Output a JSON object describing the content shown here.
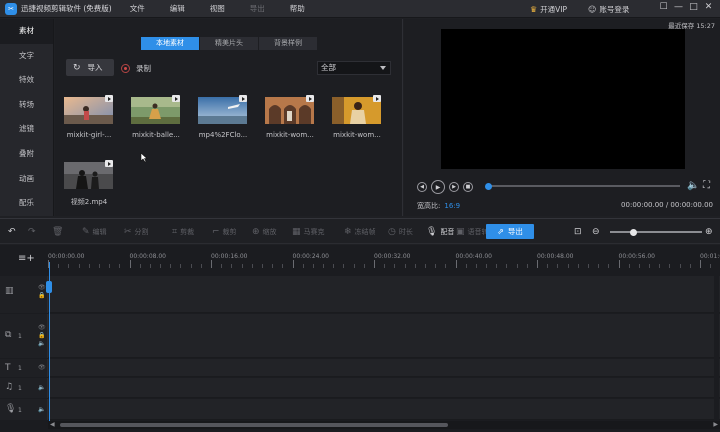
{
  "app": {
    "title": "迅捷视频剪辑软件 (免费版)",
    "logo_icon": "scissors-logo",
    "vip_label": "开通VIP",
    "login_label": "账号登录"
  },
  "menu": [
    "文件",
    "编辑",
    "视图",
    "导出",
    "帮助"
  ],
  "window_buttons": {
    "skin": "☐",
    "minimize": "—",
    "maximize": "□",
    "close": "✕"
  },
  "leftnav": [
    "素材",
    "文字",
    "特效",
    "转场",
    "滤镜",
    "叠附",
    "动画",
    "配乐"
  ],
  "media": {
    "tabs": [
      "本地素材",
      "精美片头",
      "背景样例"
    ],
    "import_label": "导入",
    "record_label": "录制",
    "filter_value": "全部",
    "items": [
      {
        "label": "mixkit-girl-...",
        "scene": "sunset-girl"
      },
      {
        "label": "mixkit-balle...",
        "scene": "ballet"
      },
      {
        "label": "mp4%2FClo...",
        "scene": "plane"
      },
      {
        "label": "mixkit-wom...",
        "scene": "arches"
      },
      {
        "label": "mixkit-wom...",
        "scene": "woman-gold"
      },
      {
        "label": "视频2.mp4",
        "scene": "silhouette"
      }
    ]
  },
  "preview": {
    "autosave": "最近保存 15:27",
    "aspect_label": "宽高比:",
    "aspect_value": "16:9",
    "timecode": "00:00:00.00 / 00:00:00.00",
    "progress": 0
  },
  "toolbar": {
    "split": "分割",
    "edit": "编辑",
    "cut": "剪裁",
    "crop": "裁剪",
    "zoom": "缩放",
    "mosaic": "马赛克",
    "freeze": "冻结帧",
    "duration": "时长",
    "dub": "配音",
    "speech": "语音转文字",
    "export": "导出",
    "zoom_level": 0.25
  },
  "timeline": {
    "ruler": [
      "00:00:00.00",
      "00:00:08.00",
      "00:00:16.00",
      "00:00:24.00",
      "00:00:32.00",
      "00:00:40.00",
      "00:00:48.00",
      "00:00:56.00",
      "00:01:04"
    ],
    "tracks": [
      {
        "type": "video",
        "icon": "film-icon",
        "num": ""
      },
      {
        "type": "overlay",
        "icon": "pip-icon",
        "num": "1"
      },
      {
        "type": "text",
        "icon": "text-icon",
        "num": "1"
      },
      {
        "type": "music",
        "icon": "music-icon",
        "num": "1"
      },
      {
        "type": "voice",
        "icon": "mic-icon",
        "num": "1"
      }
    ]
  }
}
